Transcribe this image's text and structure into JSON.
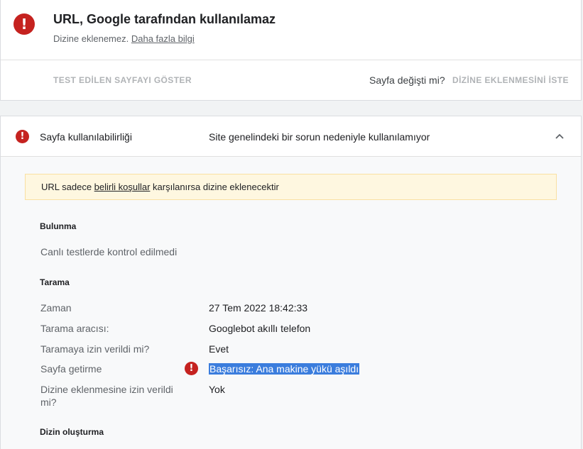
{
  "header": {
    "title": "URL, Google tarafından kullanılamaz",
    "subtitle_text": "Dizine eklenemez.",
    "subtitle_link": "Daha fazla bilgi",
    "test_button": "TEST EDİLEN SAYFAYI GÖSTER",
    "page_changed": "Sayfa değişti mi?",
    "request_index_button": "DİZİNE EKLENMESİNİ İSTE",
    "error_icon": "!"
  },
  "availability": {
    "label": "Sayfa kullanılabilirliği",
    "value": "Site genelindeki bir sorun nedeniyle kullanılamıyor",
    "notice_pre": "URL sadece ",
    "notice_link": "belirli koşullar",
    "notice_post": " karşılanırsa dizine eklenecektir"
  },
  "discovery": {
    "heading": "Bulunma",
    "text": "Canlı testlerde kontrol edilmedi"
  },
  "crawl": {
    "heading": "Tarama",
    "rows": [
      {
        "label": "Zaman",
        "value": "27 Tem 2022 18:42:33"
      },
      {
        "label": "Tarama aracısı:",
        "value": "Googlebot akıllı telefon"
      },
      {
        "label": "Taramaya izin verildi mi?",
        "value": "Evet"
      },
      {
        "label": "Sayfa getirme",
        "value": "Başarısız: Ana makine yükü aşıldı"
      },
      {
        "label": "Dizine eklenmesine izin verildi mi?",
        "value": "Yok"
      }
    ]
  },
  "indexing": {
    "heading": "Dizin oluşturma"
  },
  "colors": {
    "error": "#c5221f",
    "notice_bg": "#fef7e0",
    "selection": "#3b7ddd"
  }
}
